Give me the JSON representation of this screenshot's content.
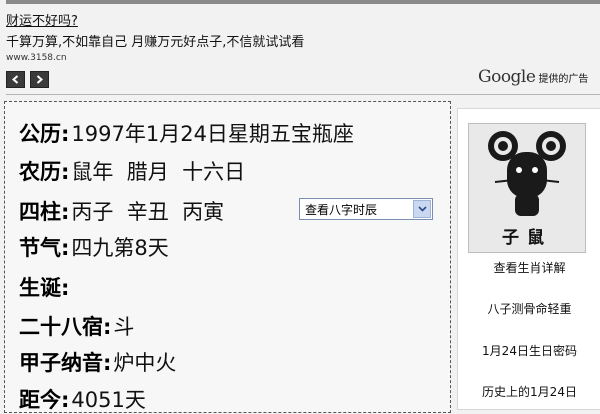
{
  "ad": {
    "title": "财运不好吗?",
    "text": "千算万算,不如靠自己  月赚万元好点子,不信就试试看",
    "url": "www.3158.cn"
  },
  "google": {
    "logo": "Google",
    "text": "提供的广告"
  },
  "info": {
    "gongli_label": "公历:",
    "gongli_value": "1997年1月24日星期五宝瓶座",
    "nongli_label": "农历:",
    "nongli_value": "鼠年  腊月  十六日",
    "sizhu_label": "四柱:",
    "sizhu_value": "丙子  辛丑  丙寅",
    "hour_select": "查看八字时辰",
    "jieqi_label": "节气:",
    "jieqi_value": "四九第8天",
    "shengdan_label": "生诞:",
    "shengdan_value": "",
    "xiu_label": "二十八宿:",
    "xiu_value": "斗",
    "nayin_label": "甲子纳音:",
    "nayin_value": "炉中火",
    "last_label": "距今:",
    "last_value": "4051天"
  },
  "side": {
    "zodiac_name": "子鼠",
    "links": [
      "查看生肖详解",
      "八子测骨命轻重",
      "1月24日生日密码",
      "历史上的1月24日"
    ]
  },
  "colors": {
    "background": "#f2f2f2",
    "select_arrow": "#c9d7f0"
  }
}
